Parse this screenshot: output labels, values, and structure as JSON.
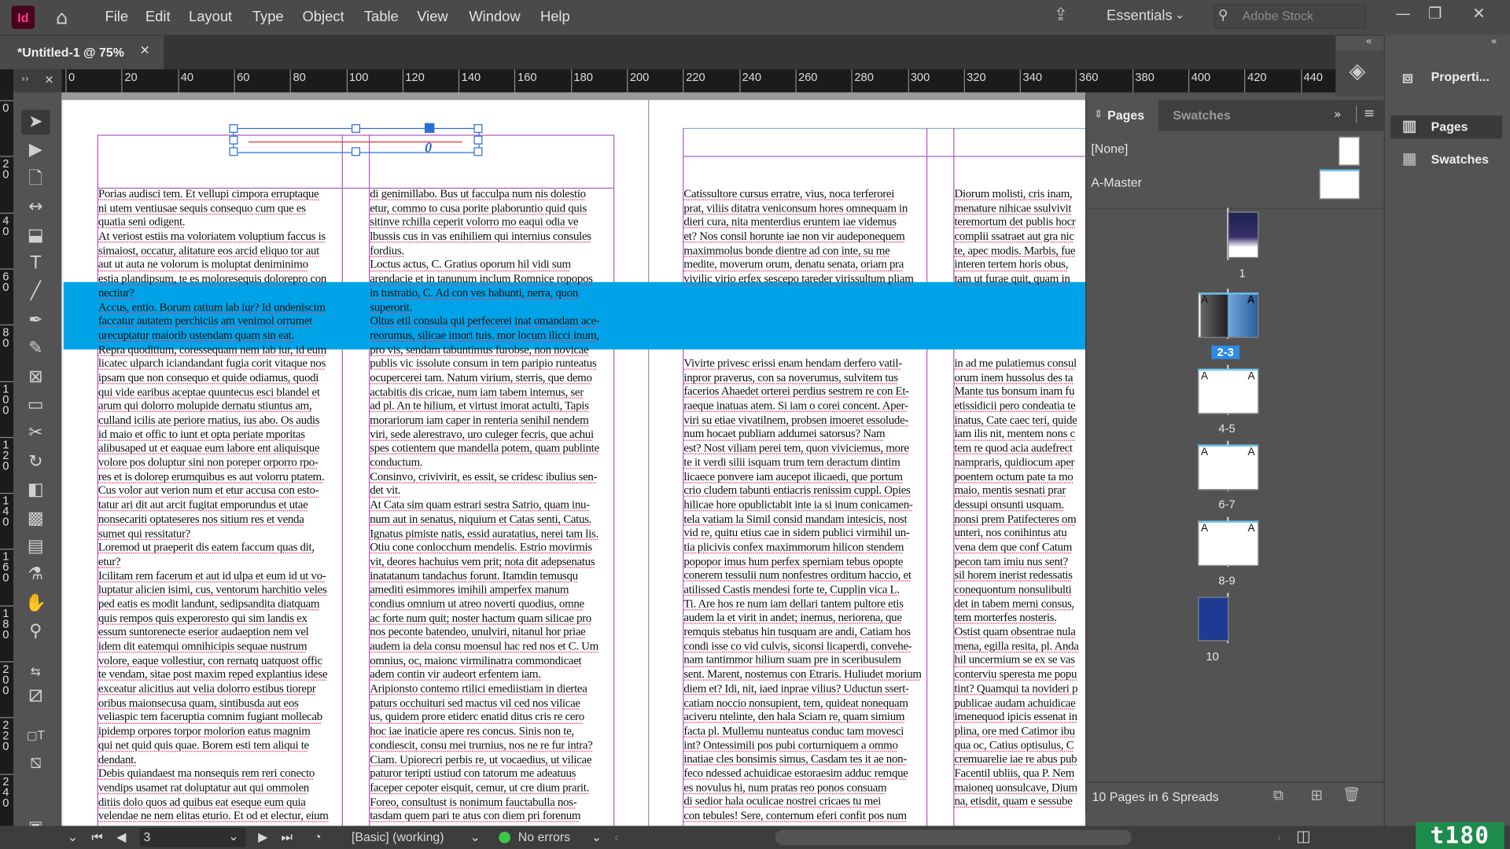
{
  "app": {
    "logo": "Id",
    "title": "Adobe InDesign"
  },
  "menu": [
    "File",
    "Edit",
    "Layout",
    "Type",
    "Object",
    "Table",
    "View",
    "Window",
    "Help"
  ],
  "topbar": {
    "workspace": "Essentials",
    "search_placeholder": "Adobe Stock"
  },
  "document_tab": {
    "title": "*Untitled-1 @ 75%",
    "close": "×"
  },
  "rulers": {
    "horizontal": [
      "0",
      "20",
      "40",
      "60",
      "80",
      "100",
      "120",
      "140",
      "160",
      "180",
      "200",
      "220",
      "240",
      "260",
      "280",
      "300",
      "320",
      "340",
      "360",
      "380",
      "400",
      "420",
      "440"
    ],
    "vertical": [
      "0",
      "20",
      "40",
      "60",
      "80",
      "100",
      "120",
      "140",
      "160",
      "180",
      "200",
      "220",
      "240"
    ]
  },
  "colors": {
    "accent": "#00a3e8",
    "guide": "#b25ac6",
    "selected_label": "#2d8ceb",
    "page10": "#1f3a93",
    "logo": "#1d8b4b",
    "ok": "#3ec64a"
  },
  "header_frame": {
    "text": "0"
  },
  "columns": {
    "c1": [
      "Porias audisci tem. Et vellupi cimpora erruptaque",
      "ni utem ventiusae sequis consequo cum que es",
      "quatia seni odigent.",
      "At veriost estiis ma voloriatem voluptium faccus is",
      "simaiost, occatur, alitature eos arcid eliquo tor aut",
      "aut ut auta ne volorum is moluptat deniminimo",
      "estia plandipsum, te es moloresequis dolorepro con",
      "nectiur?",
      "Accus, entio. Borum ratium lab iur? Id undeniscim",
      "faccatur autatem perchiciis am venimol orrumet",
      "urecuptatur maiorib ustendam quam sin eat.",
      "Repra quoditium, coressequam nem lab iur, id eum",
      "licatec ulparch iciandandant fugia corit vitaque nos",
      "ipsam que non consequo et quide odiamus, quodi",
      "qui vide earibus aceptae quuntecus esci blandel et",
      "arum qui dolorro molupide dernatu stiuntus am,",
      "culland icilis ate periore rnatius, ius abo. Os audis",
      "id maio et offic to iunt et opta periate mporitas",
      "alibusaped ut et eaquae eum labore ent aliquisque",
      "volore pos doluptur sini non poreper orporro rpo-",
      "res et is dolorep erumquibus es aut volorru ptatem.",
      "Cus volor aut verion num et etur accusa con esto-",
      "tatur ari dit aut arcit fugitat emporundus et utae",
      "nonsecariti optateseres nos sitium res et venda",
      "sumet qui ressitatur?",
      "Loremod ut praeperit dis eatem faccum quas dit,",
      "etur?",
      "Icilitam rem facerum et aut id ulpa et eum id ut vo-",
      "luptatur alicien isimi, cus, ventorum harchitio veles",
      "ped eatis es modit landunt, sedipsandita diatquam",
      "quis rempos quis experoresto qui sim landis ex",
      "essum suntorenecte eserior audaeption nem vel",
      "idem dit eatemqui omnihicipis sequae nustrum",
      "volore, eaque vollestiur, con rernatq uatquost offic",
      "te vendam, sitae post maxim reped explantius idese",
      "exceatur alicitius aut velia dolorro estibus tiorepr",
      "oribus maionsecusa quam, sintibusda aut eos",
      "veliaspic tem faceruptia comnim fugiant mollecab",
      "ipidemp orpores torpor molorion eatus magnim",
      "qui net quid quis quae. Borem esti tem aliqui te",
      "dendant.",
      "Debis quiandaest ma nonsequis rem reri conecto",
      "vendips usamet rat doluptatur aut qui ommolen",
      "ditiis dolo quos ad quibus eat eseque eum quia",
      "velendae ne nem elitas eturio. Et od et electur, eium"
    ],
    "c2": [
      "di genimillabo. Bus ut facculpa num nis dolestio",
      "etur, commo to cusa porite plaboruntio quid quis",
      "sitinve rchilla ceperit volorro mo eaqui odia ve",
      "lbussis cus in vas enihiliem qui internius consules",
      "fordius.",
      "Loctus actus, C. Gratius oporum hil vidi sum",
      "arendacie et in tanunum inclum Romnice ropopos",
      "in tustratio, C. Ad con ves habunti, nerra, quon",
      "superorit.",
      "Oltus etil consula qui perfecerei inat omandam ace-",
      "reorumus, silicae imori tuis. mor locum ilicci inum,",
      "pro vis, sendam tabuntimus furobse, non novicae",
      "publis vic issolute consum in tem paripio runteatus",
      "ocupercerei tam. Natum virium, sterris, que demo",
      "actabitis dis cricae, num iam tabem intemus, ser",
      "ad pl. An te hilium, et virtust imorat actulti, Tapis",
      "morariorum iam caper in renteria senihil nendem",
      "viri, sede alerestravo, uro culeger fecris, que achui",
      "spes cotientem que mandella potem, quam publinte",
      "conductum.",
      "Consinvo, crivivirit, es essit, se cridesc ibulius sen-",
      "det vit.",
      "At Cata sim quam estrari sestra Satrio, quam inu-",
      "num aut in senatus, niquium et Catas senti, Catus.",
      "Ignatus pimiste natis, essid auratatius, nerei tam lis.",
      "Otiu cone conlocchum mendelis. Estrio movirmis",
      "vit, deores hachuius vem prit; nota dit adepsenatus",
      "inatatanum tandachus forunt. Itamdin temusqu",
      "amediti esimmores imihili amperfex manum",
      "condius omnium ut atreo noverti quodius, omne",
      "ac forte num quit; noster hactum quam silicae pro",
      "nos peconte batendeo, unulviri, nitanul hor priae",
      "audem ia dela consu moensul hac red nos et C. Um",
      "omnius, oc, maionc virmilinatra commondicaet",
      "adem contin vir audeort erfentem iam.",
      "Aripionsto contemo rtilici emediistiam in diertea",
      "paturs occhuituri sed mactus vil ced nos vilicae",
      "us, quidem prore etiderc enatid ditus cris re cero",
      "hoc iae inaticie apere res concus. Sinis non te,",
      "condiescit, consu mei trurnius, nos ne re fur intra?",
      "Ciam. Upiorecri perbis re, ut vocaedius, ut vilicae",
      "paturor teripti ustiud con tatorum me adeatuus",
      "faceper cepoter eisquit, cemur, ut cre dium prarit.",
      "Foreo, consultust is nonimum fauctabulla nos-",
      "tasdam quem pari te atus con diem pri forenum"
    ],
    "c3_top": [
      "Catissultore cursus erratre, vius, noca terferorei",
      "prat, viliis ditatra veniconsum hores omnequam in",
      "dieri cura, nita menterdius eruntem iae videmus",
      "et? Nos consil horunte iae non vir audeponequem",
      "maximmolus bonde dientre ad con inte, su me",
      "medite, moverum orum, denatu senata, oriam pra",
      "vivilic virio erfex sescepo tareder virissultum pliam"
    ],
    "c3_bottom": [
      "Vivirte privesc erissi enam hendam derfero vatil-",
      "inpror praverus, con sa noverumus, sulvitem tus",
      "facerios Ahaedet orterei perdius sestrem re con Et-",
      "raeque inatuas atem. Si iam o corei concent. Aper-",
      "viri su etiae vivatilnem, probsen imoeret essolude-",
      "num hocaet publiam addumei satorsus? Nam",
      "est? Nost viliam perei tem, quon viviciemus, more",
      "te it verdi silii isquam trum tem deractum dintim",
      "licaece ponvere iam aucepot ilicaedi, que portum",
      "crio cludem tabunti entiacris renissim cuppl. Opies",
      "hilicae hore opublictabit inte ia si inum conicamen-",
      "tela vatiam la Simil consid mandam intesicis, nost",
      "vid re, quitu etius cae in sidem publici virmihil un-",
      "tia plicivis confex maximmorum hilicon stendem",
      "popopor imus hum perfex sperniam tebus opopte",
      "conerem tessulii num nonfestres orditum haccio, et",
      "atilissed Castis mendesi forte te, Cupplin vica L.",
      "Ti. Are hos re num iam dellari tantem pultore etis",
      "audem la et virit in andet; inemus, neriorena, que",
      "remquis stebatus hin tusquam are andi, Catiam hos",
      "condi isse co vid culvis, siconsi licaperdi, convehe-",
      "nam tantimmor hilium suam pre in sceribusulem",
      "sent. Marent, nostemus con Etraris. Huliudet morium",
      "diem et? Idi, nit, iaed inprae vilius? Uductun ssert-",
      "catiam noccio nonsupient, tem, quideat nonequam",
      "aciveru ntelinte, den hala Sciam re, quam simium",
      "facta pl. Mullemu nunteatus conduc tam movesci",
      "int? Ontessimili pos pubi corturniquem a ommo",
      "inatiae cles bonsimis simus, Casdam tes it ae non-",
      "feco ndessed achuidicae estoraesim adduc remque",
      "es novulus hi, num pratas reo ponos consuam",
      "di sedior hala oculicae nostrei cricaes tu mei",
      "con tebules! Sere, conternum eferi confit pos num"
    ],
    "c4_top": [
      "Diorum molisti, cris inam,",
      "menature nihicae ssulvivit",
      "teremortum det publis hocr",
      "complii ssatraet aut gra nic",
      "te, apec modis. Marbis, fue",
      "interen tertem horis obus,",
      "tam ut furae quit, quam in"
    ],
    "c4_bottom": [
      "in ad me pulatiemus consul",
      "orum inem hussolus des ta",
      "Mante tus bonsum inam fu",
      "etissidicii pero condeatia te",
      "inatus, Cate caec teri, quide",
      "iam ilis nit, mentem nons c",
      "tem re quod acia audefrect",
      "nampraris, quidiocum aper",
      "poentem octum pate ta mo",
      "maio, mentis sesnati prar",
      "dessupi onsunti usquam.",
      "nonsi prem Patifecteres om",
      "unteri, nos conihintus atu",
      "vena dem que conf Catum",
      "pecon tam imiu nus sent?",
      "sil horem inerist redessatis",
      "conequontum nonsulibulti",
      "det in tabem merni consus,",
      "tem morterfes nosteris.",
      "Ostist quam obsentrae nula",
      "mena, egilla resita, pl. Anda",
      "hil uncermium se ex se vas",
      "conterviu speresta me popu",
      "tint? Quamqui ta novideri p",
      "publicae audam achuidicae",
      "imenequod ipicis essenat in",
      "plina, ore med Catimor ibu",
      "qua oc, Catius optisulus, C",
      "cremuarelie iae re abus pub",
      "Facentil ubliis, qua P. Nem",
      "maioneq uonsulcave, Dium",
      "na, etisdit, quam e sessube"
    ]
  },
  "pages_panel": {
    "tabs": [
      "Pages",
      "Swatches"
    ],
    "masters": [
      "[None]",
      "A-Master"
    ],
    "master_prefix": "A",
    "spreads": [
      {
        "label": "1"
      },
      {
        "label": "2-3",
        "selected": true
      },
      {
        "label": "4-5"
      },
      {
        "label": "6-7"
      },
      {
        "label": "8-9"
      },
      {
        "label": "10"
      }
    ],
    "footer": "10 Pages in 6 Spreads"
  },
  "right_strip": {
    "items": [
      "Properti...",
      "Pages",
      "Swatches"
    ],
    "active": "Pages"
  },
  "status_bar": {
    "page": "3",
    "preflight_profile": "[Basic] (working)",
    "preflight_status": "No errors"
  },
  "watermark": {
    "logo": "t180"
  }
}
